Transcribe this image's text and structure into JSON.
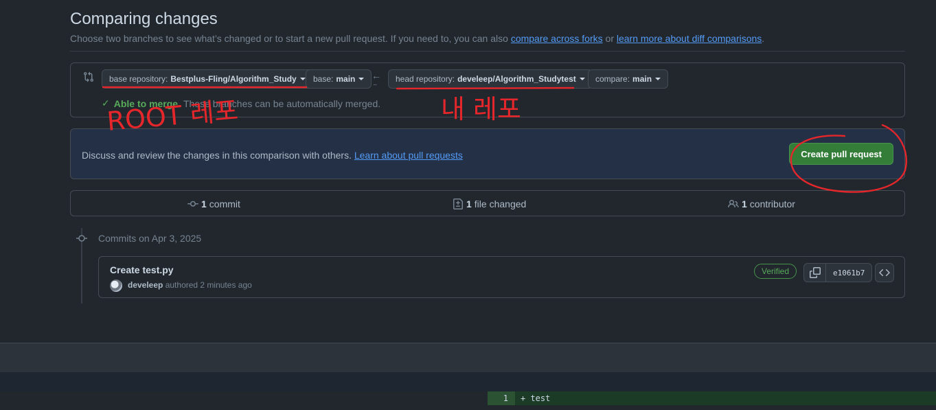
{
  "header": {
    "title": "Comparing changes",
    "desc_prefix": "Choose two branches to see what’s changed or to start a new pull request. If you need to, you can also ",
    "compare_forks_link": "compare across forks",
    "desc_or": " or ",
    "learn_diff_link": "learn more about diff comparisons",
    "desc_suffix": "."
  },
  "range": {
    "base_repo_label": "base repository:",
    "base_repo_value": "Bestplus-Fling/Algorithm_Study",
    "base_branch_label": "base:",
    "base_branch_value": "main",
    "arrow": "←",
    "dots": "...",
    "head_repo_label": "head repository:",
    "head_repo_value": "develeep/Algorithm_Studytest",
    "compare_label": "compare:",
    "compare_value": "main",
    "merge_check": "✓",
    "merge_ok": "Able to merge.",
    "merge_text": "These branches can be automatically merged."
  },
  "discuss": {
    "text": "Discuss and review the changes in this comparison with others. ",
    "link": "Learn about pull requests",
    "button": "Create pull request"
  },
  "stats": {
    "commits_count": "1",
    "commits_label": "commit",
    "files_count": "1",
    "files_label": "file changed",
    "contributors_count": "1",
    "contributors_label": "contributor"
  },
  "timeline": {
    "date_label": "Commits on Apr 3, 2025",
    "commit": {
      "title": "Create test.py",
      "author": "develeep",
      "meta": " authored 2 minutes ago",
      "verified": "Verified",
      "sha": "e1061b7"
    }
  },
  "diff": {
    "line_number": "1",
    "line_code": "+ test"
  },
  "annotations": {
    "color": "#e5262b",
    "left_text": "ROOT 레포",
    "right_text": "내 레포"
  }
}
